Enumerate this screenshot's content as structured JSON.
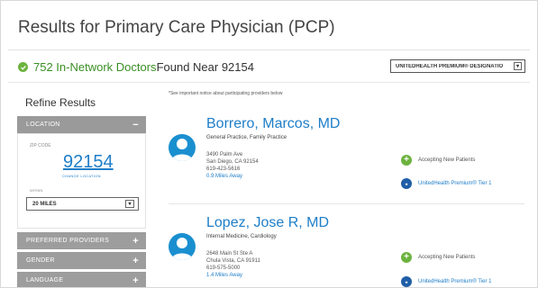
{
  "header": {
    "title": "Results for Primary Care Physician (PCP)"
  },
  "summary": {
    "count_text": "752 In-Network Doctors",
    "suffix_text": " Found Near 92154"
  },
  "designation_select": {
    "value": "UNITEDHEALTH PREMIUM® DESIGNATIO"
  },
  "notice": "*See important notice about participating providers below",
  "sidebar": {
    "title": "Refine Results",
    "location": {
      "label": "LOCATION",
      "toggle": "−",
      "zip_label": "ZIP CODE",
      "zip_value": "92154",
      "change_location": "CHANGE LOCATION",
      "within_label": "WITHIN",
      "within_value": "20 MILES"
    },
    "filters": [
      {
        "label": "PREFERRED PROVIDERS",
        "toggle": "+"
      },
      {
        "label": "GENDER",
        "toggle": "+"
      },
      {
        "label": "LANGUAGE",
        "toggle": "+"
      }
    ]
  },
  "results": [
    {
      "name": "Borrero, Marcos, MD",
      "specialty": "General Practice, Family Practice",
      "address1": "3490 Palm Ave",
      "address2": "San Diego, CA 92154",
      "phone": "619-423-5616",
      "distance": "0.9 Miles Away",
      "accepting": "Accepting New Patients",
      "tier": "UnitedHealth Premium® Tier 1"
    },
    {
      "name": "Lopez, Jose R, MD",
      "specialty": "Internal Medicine, Cardiology",
      "address1": "2648 Main St Ste A",
      "address2": "Chula Vista, CA 91911",
      "phone": "619-575-5000",
      "distance": "1.4 Miles Away",
      "accepting": "Accepting New Patients",
      "tier": "UnitedHealth Premium® Tier 1"
    }
  ],
  "icons": {
    "check": "check-circle-icon",
    "plus": "plus-circle-icon",
    "tier": "tier-badge-icon",
    "avatar": "person-avatar-icon",
    "dropdown": "chevron-down-icon"
  },
  "colors": {
    "link_blue": "#1e7ec8",
    "green": "#6db33f",
    "sidebar_gray": "#9d9d9d",
    "avatar_blue": "#1a8fd0"
  }
}
